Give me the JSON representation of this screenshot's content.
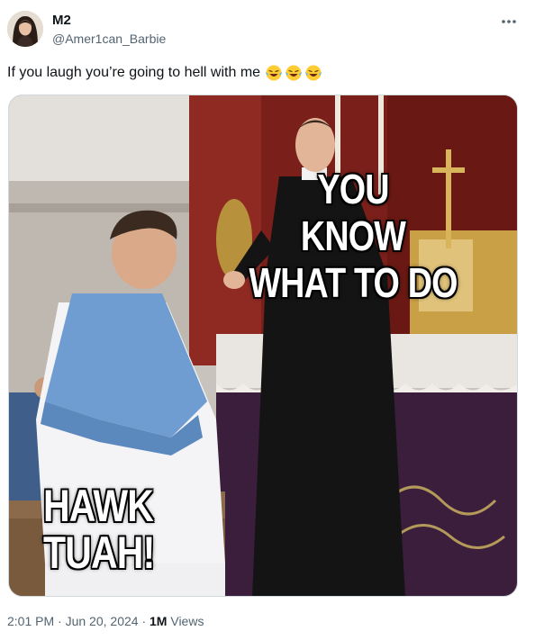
{
  "post": {
    "display_name": "M2",
    "handle": "@Amer1can_Barbie",
    "text": "If you laugh you’re going to hell with me",
    "emojis": [
      "face-with-tears-of-joy-icon",
      "face-with-tears-of-joy-icon",
      "face-with-tears-of-joy-icon"
    ],
    "more_icon": "more-horizontal-icon"
  },
  "media": {
    "caption_top": "YOU\nKNOW\nWHAT TO DO",
    "caption_bottom": "HAWK\nTUAH!"
  },
  "meta": {
    "time": "2:01 PM",
    "separator": "·",
    "date": "Jun 20, 2024",
    "views_count": "1M",
    "views_label": "Views"
  },
  "colors": {
    "text_primary": "#0f1419",
    "text_secondary": "#536471",
    "border": "#cfd9de"
  }
}
